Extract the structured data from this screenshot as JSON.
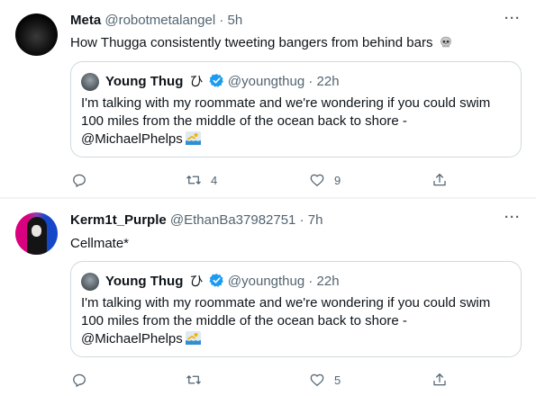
{
  "tweets": [
    {
      "author": {
        "name": "Meta",
        "handle": "@robotmetalangel",
        "time": "5h"
      },
      "text": "How Thugga consistently tweeting bangers from behind bars",
      "text_emoji": "skull-icon",
      "quote": {
        "author": {
          "name": "Young Thug",
          "glyph": "ひ",
          "handle": "@youngthug",
          "time": "22h",
          "verified": true
        },
        "lines": [
          "I'm talking with my roommate and we're wondering if you could swim",
          "100 miles from the middle of the ocean back to shore -",
          "@MichaelPhelps"
        ],
        "emoji": "swimmer-icon"
      },
      "actions": {
        "replies": "",
        "retweets": "4",
        "likes": "9"
      }
    },
    {
      "author": {
        "name": "Kerm1t_Purple",
        "handle": "@EthanBa37982751",
        "time": "7h"
      },
      "text": "Cellmate*",
      "quote": {
        "author": {
          "name": "Young Thug",
          "glyph": "ひ",
          "handle": "@youngthug",
          "time": "22h",
          "verified": true
        },
        "lines": [
          "I'm talking with my roommate and we're wondering if you could swim",
          "100 miles from the middle of the ocean back to shore -",
          "@MichaelPhelps"
        ],
        "emoji": "swimmer-icon"
      },
      "actions": {
        "replies": "",
        "retweets": "",
        "likes": "5"
      }
    }
  ],
  "separator": "·",
  "more_label": "···",
  "colors": {
    "text": "#0f1419",
    "muted": "#536471",
    "border": "#cfd9de",
    "verified": "#1d9bf0"
  }
}
